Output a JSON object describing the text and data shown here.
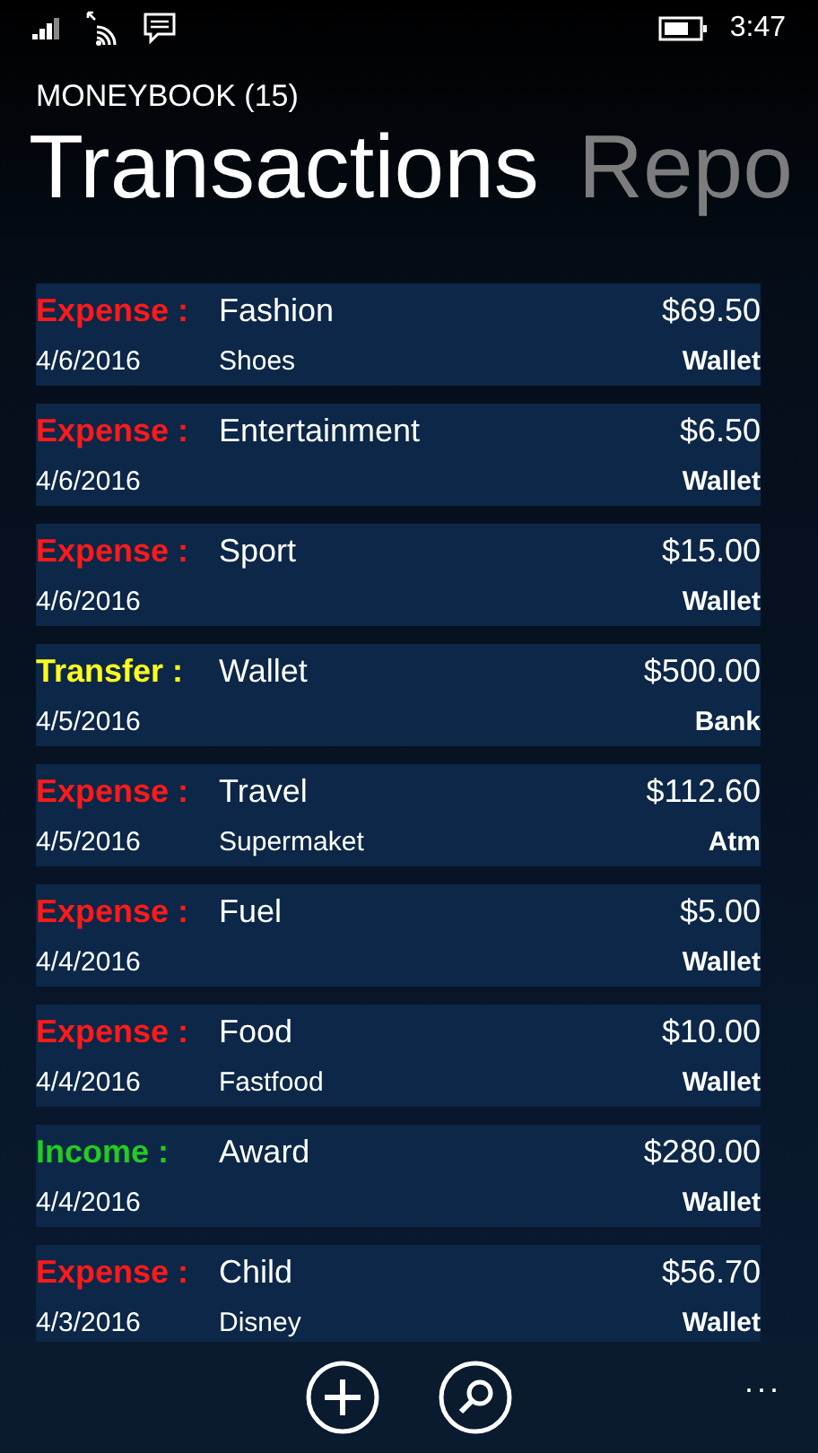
{
  "status_bar": {
    "time": "3:47"
  },
  "header": {
    "app_title": "MONEYBOOK (15)",
    "pivots": [
      {
        "label": "Transactions",
        "selected": true
      },
      {
        "label": "Repo",
        "selected": false
      }
    ]
  },
  "transactions": [
    {
      "kind": "expense",
      "type": "Expense :",
      "category": "Fashion",
      "amount": "$69.50",
      "date": "4/6/2016",
      "note": "Shoes",
      "account": "Wallet"
    },
    {
      "kind": "expense",
      "type": "Expense :",
      "category": "Entertainment",
      "amount": "$6.50",
      "date": "4/6/2016",
      "account": "Wallet"
    },
    {
      "kind": "expense",
      "type": "Expense :",
      "category": "Sport",
      "amount": "$15.00",
      "date": "4/6/2016",
      "account": "Wallet"
    },
    {
      "kind": "transfer",
      "type": "Transfer :",
      "category": "Wallet",
      "amount": "$500.00",
      "date": "4/5/2016",
      "account": "Bank"
    },
    {
      "kind": "expense",
      "type": "Expense :",
      "category": "Travel",
      "amount": "$112.60",
      "date": "4/5/2016",
      "note": "Supermaket",
      "account": "Atm"
    },
    {
      "kind": "expense",
      "type": "Expense :",
      "category": "Fuel",
      "amount": "$5.00",
      "date": "4/4/2016",
      "account": "Wallet"
    },
    {
      "kind": "expense",
      "type": "Expense :",
      "category": "Food",
      "amount": "$10.00",
      "date": "4/4/2016",
      "note": "Fastfood",
      "account": "Wallet"
    },
    {
      "kind": "income",
      "type": "Income :",
      "category": "Award",
      "amount": "$280.00",
      "date": "4/4/2016",
      "account": "Wallet"
    },
    {
      "kind": "expense",
      "type": "Expense :",
      "category": "Child",
      "amount": "$56.70",
      "date": "4/3/2016",
      "note": "Disney",
      "account": "Wallet"
    }
  ],
  "app_bar": {
    "more": "..."
  }
}
